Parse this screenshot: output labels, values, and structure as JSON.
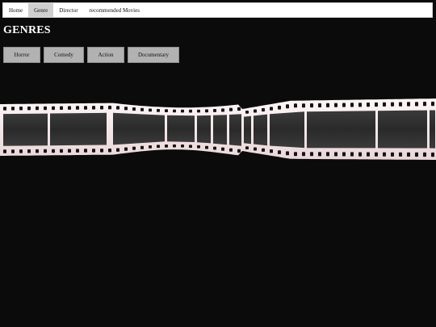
{
  "nav": {
    "items": [
      {
        "label": "Home",
        "active": false
      },
      {
        "label": "Genre",
        "active": true
      },
      {
        "label": "Director",
        "active": false
      },
      {
        "label": "recommended Movies",
        "active": false
      }
    ]
  },
  "page": {
    "title": "GENRES"
  },
  "genres": {
    "buttons": [
      {
        "label": "Horror"
      },
      {
        "label": "Comedy"
      },
      {
        "label": "Action"
      },
      {
        "label": "Documentary"
      }
    ]
  },
  "decor": {
    "film_strip": "film-strip-image"
  },
  "colors": {
    "background": "#0b0b0b",
    "nav_active": "#cfcfcf",
    "button": "#b2b2b2",
    "film_edge": "#f2e4e6"
  }
}
